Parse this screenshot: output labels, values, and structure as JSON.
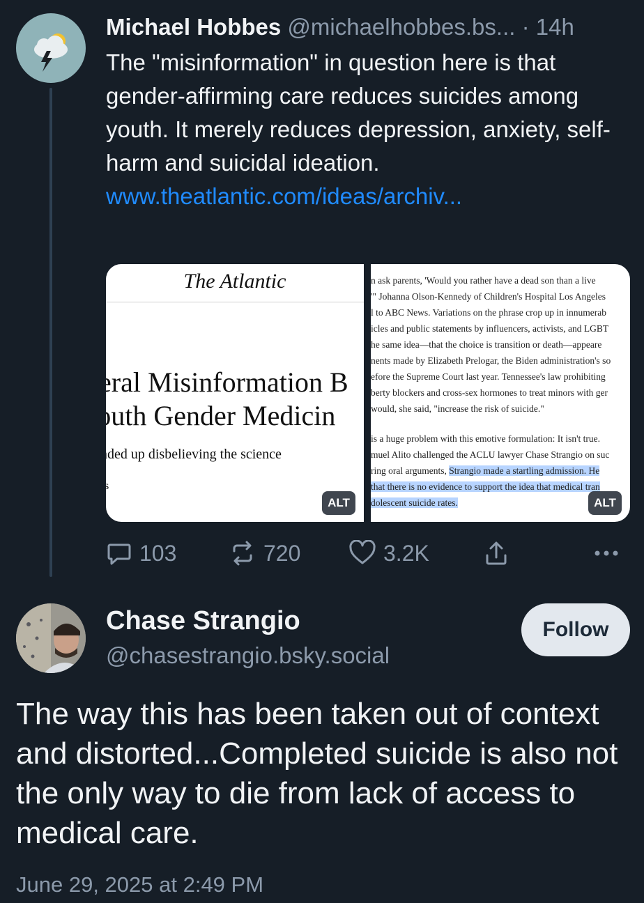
{
  "post1": {
    "author_name": "Michael Hobbes",
    "handle": "@michaelhobbes.bs...",
    "time": "· 14h",
    "text": "The \"misinformation\" in question here is that gender-affirming care reduces suicides among youth. It merely reduces depression, anxiety, self-harm and suicidal ideation.",
    "link": "www.theatlantic.com/ideas/archiv...",
    "avatar_icon": "storm-cloud-icon",
    "images": {
      "left": {
        "masthead": "The Atlantic",
        "headline_line1": "eral Misinformation B",
        "headline_line2": "'outh Gender Medicin",
        "deck": "nded up disbelieving the science",
        "stray": "s",
        "alt_label": "ALT"
      },
      "right": {
        "lines": [
          "n ask parents, 'Would you rather have a dead son than a live",
          "'\" Johanna Olson-Kennedy of Children's Hospital Los Angeles",
          "l to ABC News. Variations on the phrase crop up in innumerab",
          "icles and public statements by influencers, activists, and LGBT",
          "he same idea—that the choice is transition or death—appeare",
          "nents made by Elizabeth Prelogar, the Biden administration's so",
          "efore the Supreme Court last year. Tennessee's law prohibiting",
          "berty blockers and cross-sex hormones to treat minors with ger",
          "would, she said, \"increase the risk of suicide.\""
        ],
        "lines2": [
          "is a huge problem with this emotive formulation: It isn't true.",
          "muel Alito challenged the ACLU lawyer Chase Strangio on suc",
          "ring oral arguments, "
        ],
        "highlight1": "Strangio made a startling admission. He",
        "highlight2": "that there is no evidence to support the idea that medical tran",
        "highlight3": "dolescent suicide rates.",
        "alt_label": "ALT"
      }
    },
    "actions": {
      "replies": "103",
      "reposts": "720",
      "likes": "3.2K"
    }
  },
  "post2": {
    "author_name": "Chase Strangio",
    "handle": "@chasestrangio.bsky.social",
    "follow_label": "Follow",
    "text": "The way this has been taken out of context and distorted...Completed suicide is also not the only way to die from lack of access to medical care.",
    "date": "June 29, 2025 at 2:49 PM"
  },
  "colors": {
    "background": "#161e27",
    "text": "#f1f3f5",
    "muted": "#8c9aab",
    "link": "#208bfe",
    "highlight": "#b7d4ff"
  }
}
